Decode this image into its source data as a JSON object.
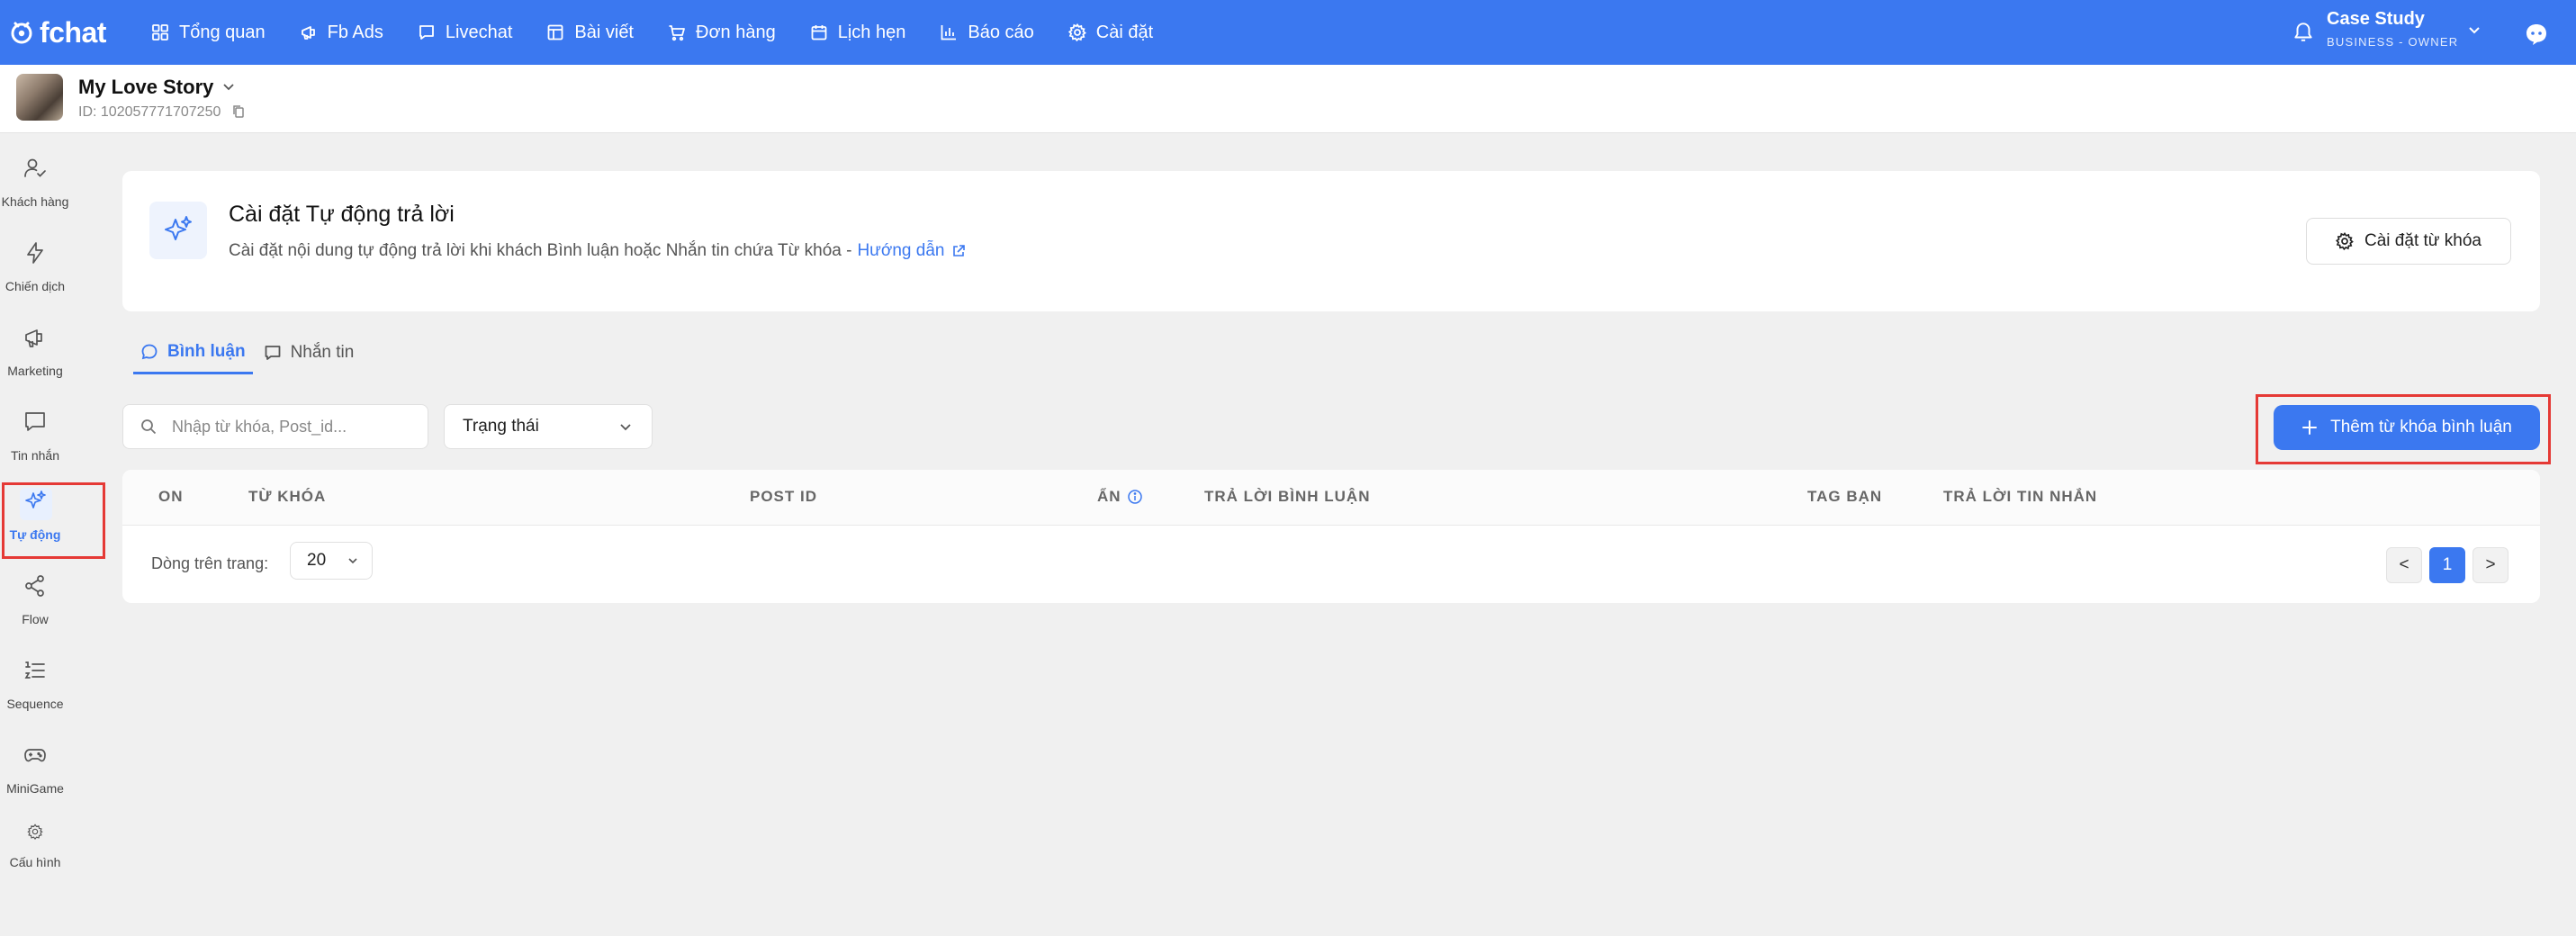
{
  "topnav": {
    "brand": "fchat",
    "items": [
      {
        "label": "Tổng quan",
        "icon": "grid-icon"
      },
      {
        "label": "Fb Ads",
        "icon": "megaphone-icon"
      },
      {
        "label": "Livechat",
        "icon": "chat-bubble-icon"
      },
      {
        "label": "Bài viết",
        "icon": "layout-icon"
      },
      {
        "label": "Đơn hàng",
        "icon": "cart-icon"
      },
      {
        "label": "Lịch hẹn",
        "icon": "calendar-icon"
      },
      {
        "label": "Báo cáo",
        "icon": "bar-chart-icon"
      },
      {
        "label": "Cài đặt",
        "icon": "gear-icon"
      }
    ],
    "account": {
      "name": "Case Study",
      "role": "BUSINESS - OWNER"
    }
  },
  "page": {
    "title": "My Love Story",
    "id_text": "ID: 102057771707250"
  },
  "sidebar": {
    "items": [
      {
        "label": "Khách hàng",
        "icon": "user-check-icon"
      },
      {
        "label": "Chiến dịch",
        "icon": "lightning-icon"
      },
      {
        "label": "Marketing",
        "icon": "megaphone-icon"
      },
      {
        "label": "Tin nhắn",
        "icon": "message-icon"
      },
      {
        "label": "Tự động",
        "icon": "sparkles-icon",
        "active": true
      },
      {
        "label": "Flow",
        "icon": "share-icon"
      },
      {
        "label": "Sequence",
        "icon": "list-ordered-icon"
      },
      {
        "label": "MiniGame",
        "icon": "gamepad-icon"
      },
      {
        "label": "Cấu hình",
        "icon": "gear-icon"
      }
    ]
  },
  "hero": {
    "title": "Cài đặt Tự động trả lời",
    "description": "Cài đặt nội dung tự động trả lời khi khách Bình luận hoặc Nhắn tin chứa Từ khóa -",
    "link": "Hướng dẫn",
    "settings_button": "Cài đặt từ khóa"
  },
  "tabs": [
    {
      "label": "Bình luận",
      "active": true
    },
    {
      "label": "Nhắn tin",
      "active": false
    }
  ],
  "filters": {
    "search_placeholder": "Nhập từ khóa, Post_id...",
    "status_label": "Trạng thái",
    "add_button": "Thêm từ khóa bình luận"
  },
  "table": {
    "columns": [
      "ON",
      "TỪ KHÓA",
      "POST ID",
      "ẨN",
      "TRẢ LỜI BÌNH LUẬN",
      "TAG BẠN",
      "TRẢ LỜI TIN NHẮN"
    ],
    "rows_per_page_label": "Dòng trên trang:",
    "rows_per_page": "20",
    "pagination": {
      "prev": "<",
      "current": "1",
      "next": ">"
    }
  },
  "colors": {
    "primary": "#3b78f0",
    "highlight": "#e53935",
    "background": "#f0f0f0"
  }
}
